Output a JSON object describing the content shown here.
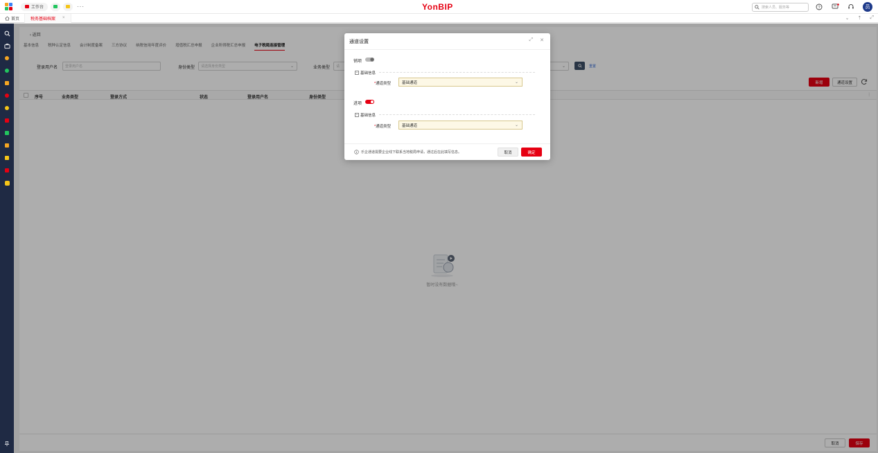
{
  "topbar": {
    "brand": "YonBIP",
    "workbench_tab": "工作台",
    "more": "···",
    "search_placeholder": "搜索人员、服务等",
    "avatar_text": "员"
  },
  "tabbar": {
    "home_label": "首页",
    "page_tab_label": "税务基础档案",
    "close_glyph": "×"
  },
  "page": {
    "back_label": "返回",
    "subtabs": [
      "基本信息",
      "税种认定信息",
      "会计制度备案",
      "三方协议",
      "纳税信用年度评价",
      "增值税汇总申报",
      "企业所得税汇总申报",
      "电子税局连接管理"
    ],
    "active_subtab_index": 7,
    "filters": {
      "login_user_label": "登录用户名",
      "login_user_placeholder": "登录用户名",
      "identity_label": "身份类型",
      "identity_placeholder": "请选择身份类型",
      "business_label": "业务类型",
      "business_placeholder": "请",
      "reset_label": "重置"
    },
    "buttons": {
      "new_label": "新增",
      "channel_label": "通道设置"
    },
    "table_headers": [
      "序号",
      "业务类型",
      "登录方式",
      "状态",
      "登录用户名",
      "身份类型"
    ],
    "empty_text": "暂时没有数据哦~",
    "footer": {
      "cancel_label": "取消",
      "save_label": "保存"
    }
  },
  "modal": {
    "title": "通道设置",
    "sections": [
      {
        "switch_label": "销项",
        "switch_on": false,
        "group_title": "基础信息",
        "field_label": "通道类型",
        "field_value": "基础通道"
      },
      {
        "switch_label": "进项",
        "switch_on": true,
        "group_title": "基础信息",
        "field_label": "通道类型",
        "field_value": "基础通道"
      }
    ],
    "footer_note": "乐企通道需要企业线下联系当地税局申请，通过后在此填写信息。",
    "cancel_label": "取消",
    "ok_label": "确定"
  },
  "colors": {
    "brand_red": "#e60012",
    "rail_bg": "#1f2a44",
    "switch_off": "#b8b8b8",
    "field_bg": "#fdf8e6"
  }
}
